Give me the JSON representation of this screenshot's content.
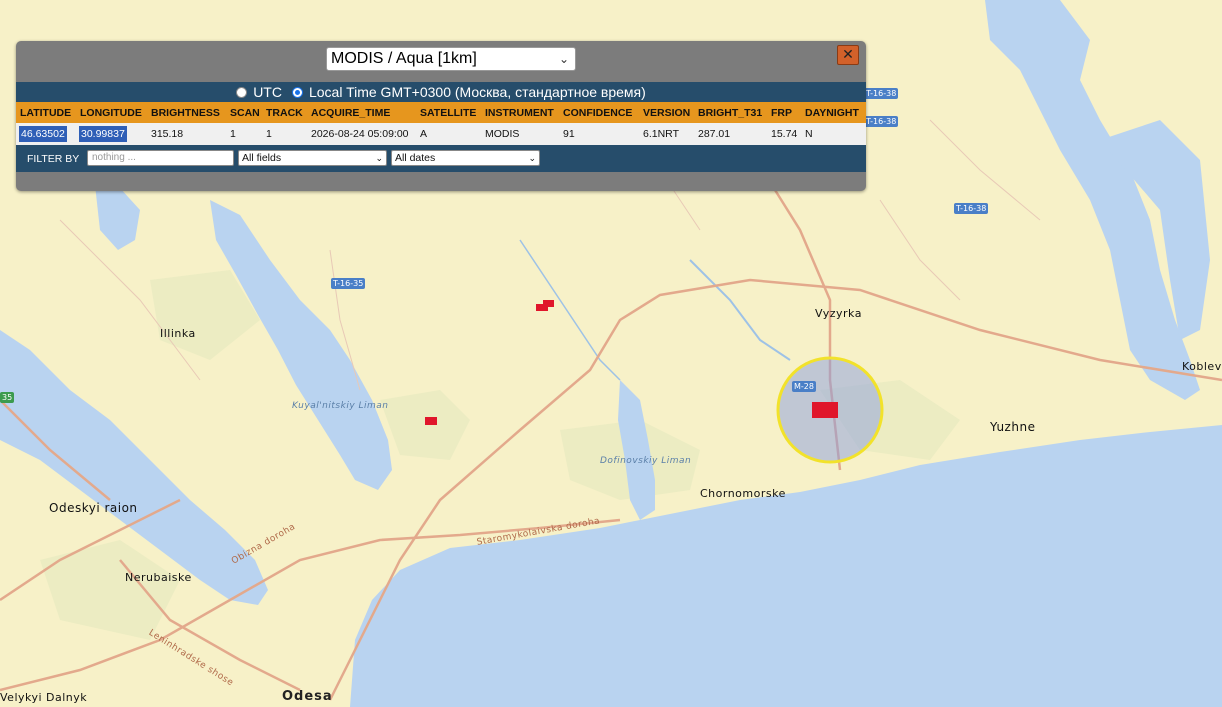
{
  "panel": {
    "sensor_select": "MODIS / Aqua [1km]",
    "close_label": "✕",
    "time_options": {
      "utc_label": "UTC",
      "local_label": "Local Time GMT+0300 (Москва, стандартное время)",
      "selected": "local"
    },
    "table": {
      "columns": [
        "LATITUDE",
        "LONGITUDE",
        "BRIGHTNESS",
        "SCAN",
        "TRACK",
        "ACQUIRE_TIME",
        "SATELLITE",
        "INSTRUMENT",
        "CONFIDENCE",
        "VERSION",
        "BRIGHT_T31",
        "FRP",
        "DAYNIGHT"
      ],
      "row": {
        "latitude": "46.63502",
        "longitude": "30.99837",
        "brightness": "315.18",
        "scan": "1",
        "track": "1",
        "acquire_time": "2026-08-24 05:09:00",
        "satellite": "A",
        "instrument": "MODIS",
        "confidence": "91",
        "version": "6.1NRT",
        "bright_t31": "287.01",
        "frp": "15.74",
        "daynight": "N"
      }
    },
    "filter": {
      "label": "FILTER BY",
      "placeholder": "nothing ...",
      "field_select": "All fields",
      "date_select": "All dates"
    }
  },
  "map": {
    "place_labels": {
      "illinka": "Illinka",
      "vyzyrka": "Vyzyrka",
      "yuzhne": "Yuzhne",
      "koblevo": "Koblevo",
      "odeskyi_raion": "Odeskyi raion",
      "nerubaiske": "Nerubaiske",
      "chornomorske": "Chornomorske",
      "odesa": "Odesa",
      "velykyi_dalnyk": "Velykyi Dalnyk"
    },
    "water_labels": {
      "kuyalnitskiy": "Kuyal'nitskiy Liman",
      "dofinovskiy": "Dofinovskiy Liman"
    },
    "road_labels": {
      "obizna": "Obizna doroha",
      "staromykolaivska": "Staromykolaivska doroha",
      "leninhradske": "Leninhradske shose"
    },
    "route_shields": {
      "t1638_a": "T-16-38",
      "t1638_b": "T-16-38",
      "t1638_c": "T-16-38",
      "t1635": "T-16-35",
      "m28": "M-28",
      "edge": "35"
    },
    "colors": {
      "land": "#f7f1c8",
      "water": "#b9d3f0",
      "fire": "#e0162b",
      "highlight_ring": "#f2e22a",
      "panel_header": "#e6961e",
      "panel_bar": "#264d6b"
    }
  }
}
